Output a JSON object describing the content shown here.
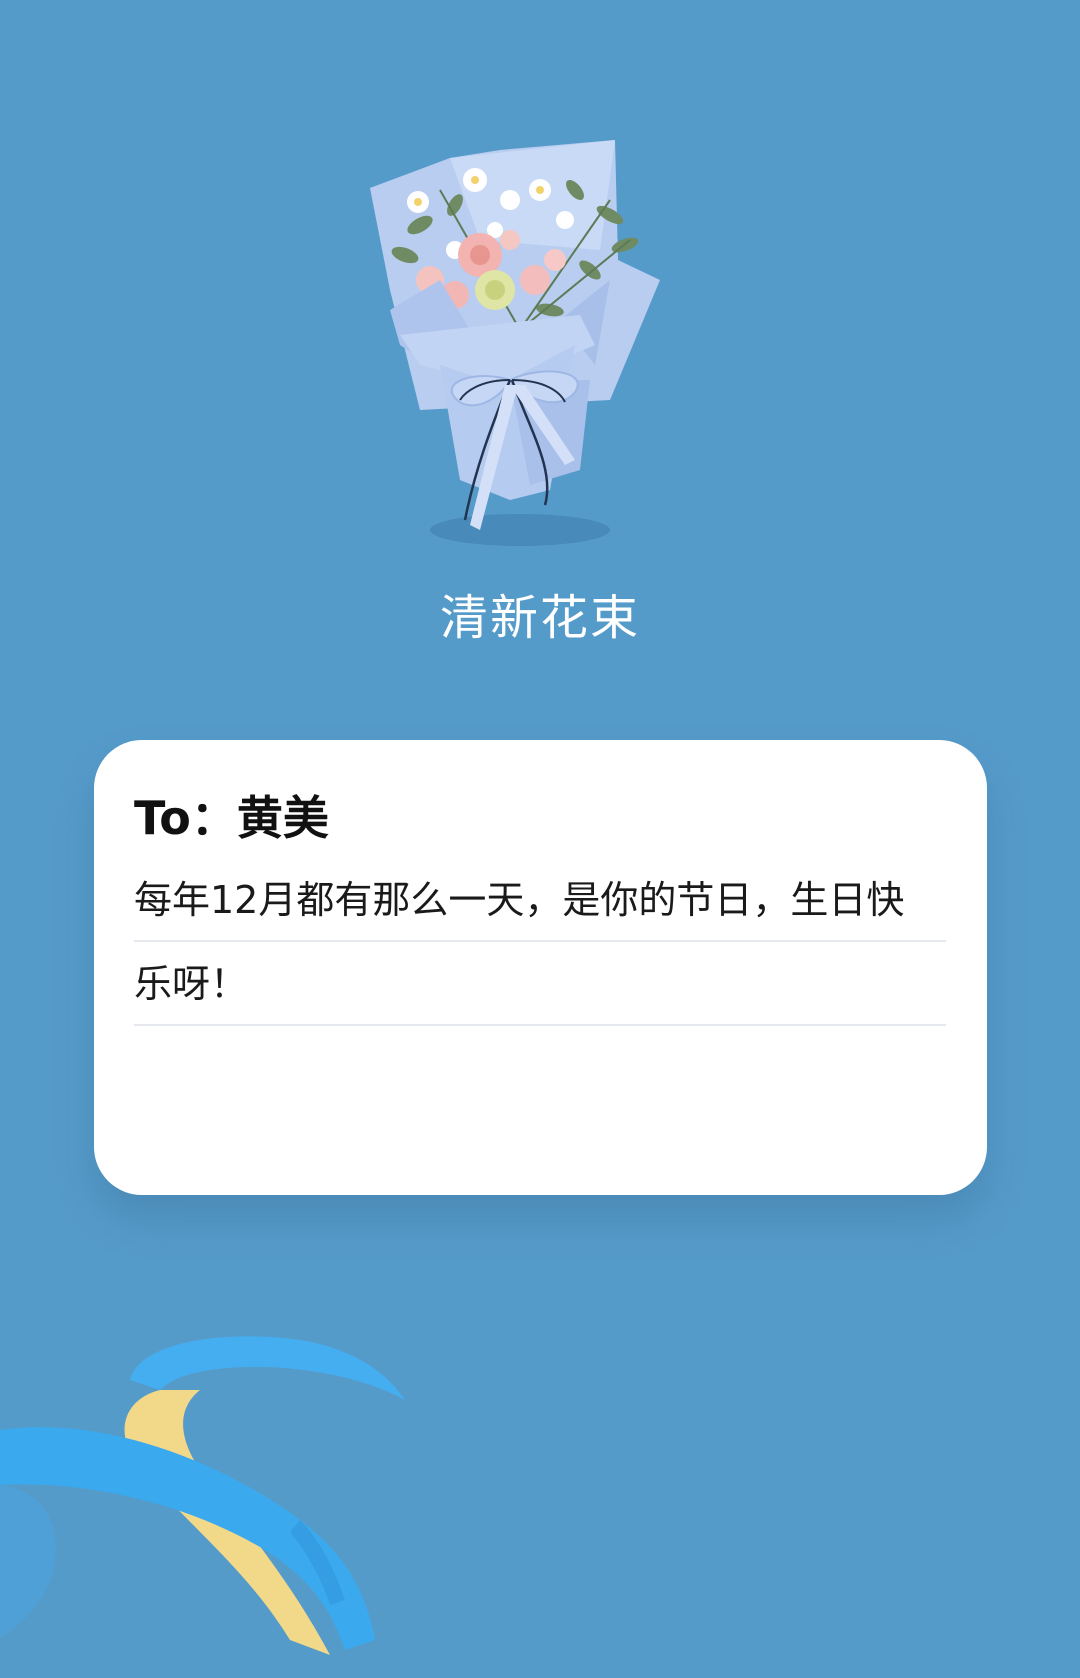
{
  "background_color": "#559bca",
  "gift": {
    "image_icon": "flower-bouquet-icon",
    "name": "清新花束"
  },
  "card": {
    "recipient_line": "To：黄美",
    "message_lines": [
      "每年12月都有那么一天，是你的节日，生日快",
      "乐呀！"
    ]
  },
  "decoration": {
    "icon": "ribbon-decoration-icon",
    "colors": [
      "#3ba9ee",
      "#f3db8b"
    ]
  }
}
